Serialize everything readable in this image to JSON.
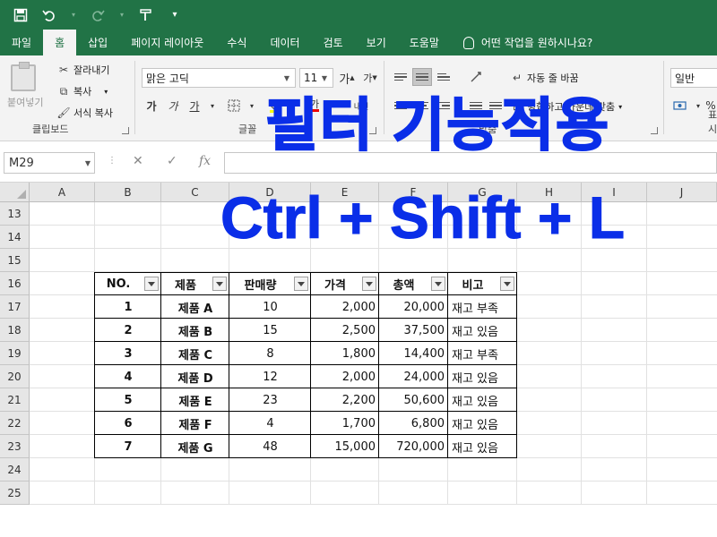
{
  "qat": {
    "icons": [
      "save-icon",
      "undo-icon",
      "redo-icon",
      "format-painter-icon",
      "customize-icon"
    ]
  },
  "tabs": [
    "파일",
    "홈",
    "삽입",
    "페이지 레이아웃",
    "수식",
    "데이터",
    "검토",
    "보기",
    "도움말"
  ],
  "active_tab": "홈",
  "tell_me": "어떤 작업을 원하시나요?",
  "clipboard": {
    "paste": "붙여넣기",
    "cut": "잘라내기",
    "copy": "복사",
    "format_painter": "서식 복사",
    "label": "클립보드"
  },
  "font": {
    "name": "맑은 고딕",
    "size": "11",
    "grow": "가",
    "shrink": "가",
    "bold": "가",
    "italic": "가",
    "underline": "가",
    "phonetic": "내천",
    "label": "글꼴"
  },
  "alignment": {
    "wrap_text": "자동 줄 바꿈",
    "merge_center": "병합하고 가운데 맞춤",
    "label": "맞춤"
  },
  "number": {
    "format": "일반",
    "percent": "%",
    "label": "표시"
  },
  "formula_bar": {
    "name_box": "M29",
    "cancel": "✕",
    "enter": "✓",
    "fx": "fx",
    "value": ""
  },
  "columns": [
    "A",
    "B",
    "C",
    "D",
    "E",
    "F",
    "G",
    "H",
    "I",
    "J"
  ],
  "rows": [
    "13",
    "14",
    "15",
    "16",
    "17",
    "18",
    "19",
    "20",
    "21",
    "22",
    "23",
    "24",
    "25"
  ],
  "table": {
    "headers": [
      "NO.",
      "제품",
      "판매량",
      "가격",
      "총액",
      "비고"
    ],
    "rows": [
      [
        "1",
        "제품 A",
        "10",
        "2,000",
        "20,000",
        "재고 부족"
      ],
      [
        "2",
        "제품 B",
        "15",
        "2,500",
        "37,500",
        "재고 있음"
      ],
      [
        "3",
        "제품 C",
        "8",
        "1,800",
        "14,400",
        "재고 부족"
      ],
      [
        "4",
        "제품 D",
        "12",
        "2,000",
        "24,000",
        "재고 있음"
      ],
      [
        "5",
        "제품 E",
        "23",
        "2,200",
        "50,600",
        "재고 있음"
      ],
      [
        "6",
        "제품 F",
        "4",
        "1,700",
        "6,800",
        "재고 있음"
      ],
      [
        "7",
        "제품 G",
        "48",
        "15,000",
        "720,000",
        "재고 있음"
      ]
    ]
  },
  "overlay": {
    "line1": "필터 기능적용",
    "line2": "Ctrl + Shift + L",
    "color": "#0a2ee8"
  },
  "colors": {
    "excel_green": "#217346"
  }
}
